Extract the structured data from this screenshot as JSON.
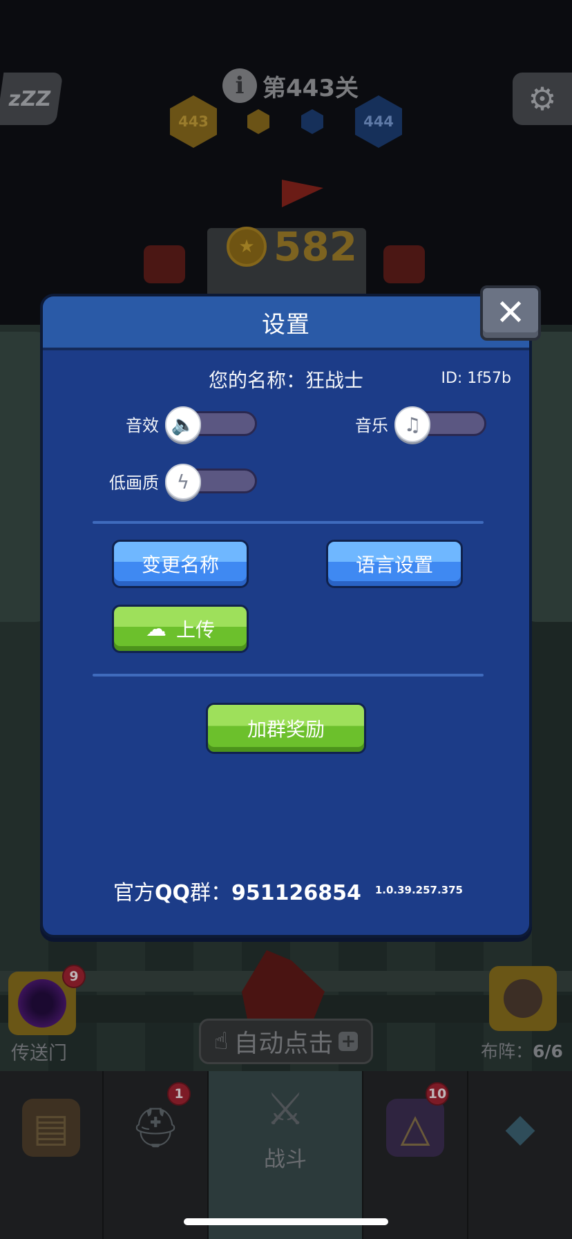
{
  "hud": {
    "sleep_label": "zZZ",
    "level_title": "第443关",
    "hex_current": "443",
    "hex_next": "444",
    "score": "582"
  },
  "modal": {
    "title": "设置",
    "name_label": "您的名称：狂战士",
    "id_label": "ID:  1f57b",
    "sound_label": "音效",
    "music_label": "音乐",
    "low_quality_label": "低画质",
    "rename_label": "变更名称",
    "language_label": "语言设置",
    "upload_label": "上传",
    "group_reward_label": "加群奖励",
    "qq_prefix": "官方",
    "qq_brand": "QQ",
    "qq_suffix": "群：",
    "qq_number": "951126854",
    "version": "1.0.39.257.375"
  },
  "bottom": {
    "portal_label": "传送门",
    "portal_badge": "9",
    "auto_click_label": "自动点击",
    "formation_prefix": "布阵：",
    "formation_count": "6/6"
  },
  "tabs": [
    {
      "icon": "chest-icon",
      "badge": ""
    },
    {
      "icon": "helmet-icon",
      "badge": "1"
    },
    {
      "icon": "crossed-swords-icon",
      "label": "战斗",
      "badge": ""
    },
    {
      "icon": "spellbook-icon",
      "badge": "10"
    },
    {
      "icon": "amulet-icon",
      "badge": ""
    }
  ],
  "colors": {
    "modal_bg": "#1c3c88",
    "modal_header": "#2a5aa7",
    "button_blue": "#3f89f2",
    "button_green": "#6cc02c",
    "toggle_track": "#5b5782"
  }
}
